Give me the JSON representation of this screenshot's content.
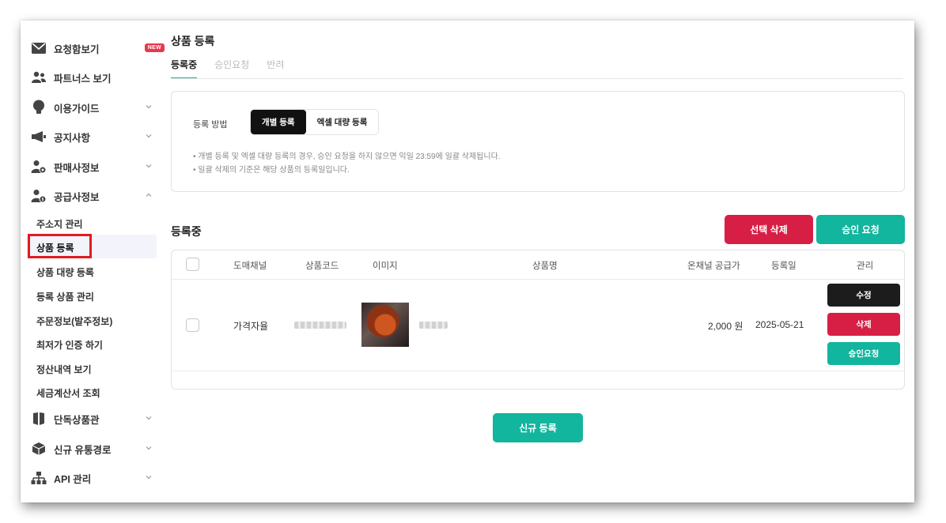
{
  "sidebar": {
    "items": [
      {
        "label": "요청함보기",
        "badge": "NEW",
        "icon": "envelope-icon"
      },
      {
        "label": "파트너스 보기",
        "icon": "people-icon"
      },
      {
        "label": "이용가이드",
        "icon": "lightbulb-icon"
      },
      {
        "label": "공지사항",
        "icon": "megaphone-icon"
      },
      {
        "label": "판매사정보",
        "icon": "seller-user-icon"
      },
      {
        "label": "공급사정보",
        "icon": "supplier-user-icon"
      }
    ],
    "sub_items": [
      "주소지 관리",
      "상품 등록",
      "상품 대량 등록",
      "등록 상품 관리",
      "주문정보(발주정보)",
      "최저가 인증 하기",
      "정산내역 보기",
      "세금계산서 조회"
    ],
    "bottom_items": [
      {
        "label": "단독상품관",
        "icon": "book-icon"
      },
      {
        "label": "신규 유통경로",
        "icon": "box-icon"
      },
      {
        "label": "API 관리",
        "icon": "network-icon"
      }
    ]
  },
  "page": {
    "title": "상품 등록",
    "tabs": [
      "등록중",
      "승인요청",
      "반려"
    ]
  },
  "method": {
    "label": "등록 방법",
    "options": [
      "개별 등록",
      "엑셀 대량 등록"
    ],
    "notes": [
      "• 개별 등록 및 엑셀 대량 등록의 경우, 승인 요청을 하지 않으면 익일 23:59에 일괄 삭제됩니다.",
      "• 일괄 삭제의 기준은 해당 상품의 등록일입니다."
    ]
  },
  "list": {
    "title": "등록중",
    "delete_selected": "선택 삭제",
    "request_approval": "승인 요청",
    "columns": [
      "도매채널",
      "상품코드",
      "이미지",
      "상품명",
      "온채널 공급가",
      "등록일",
      "관리"
    ],
    "rows": [
      {
        "channel": "가격자율",
        "price": "2,000 원",
        "date": "2025-05-21",
        "actions": [
          "수정",
          "삭제",
          "승인요청"
        ]
      }
    ]
  },
  "new_button": "신규 등록",
  "colors": {
    "accent": "#12b59d",
    "danger": "#d71f45",
    "dark": "#1c1c1c",
    "highlight": "#e01b22"
  }
}
